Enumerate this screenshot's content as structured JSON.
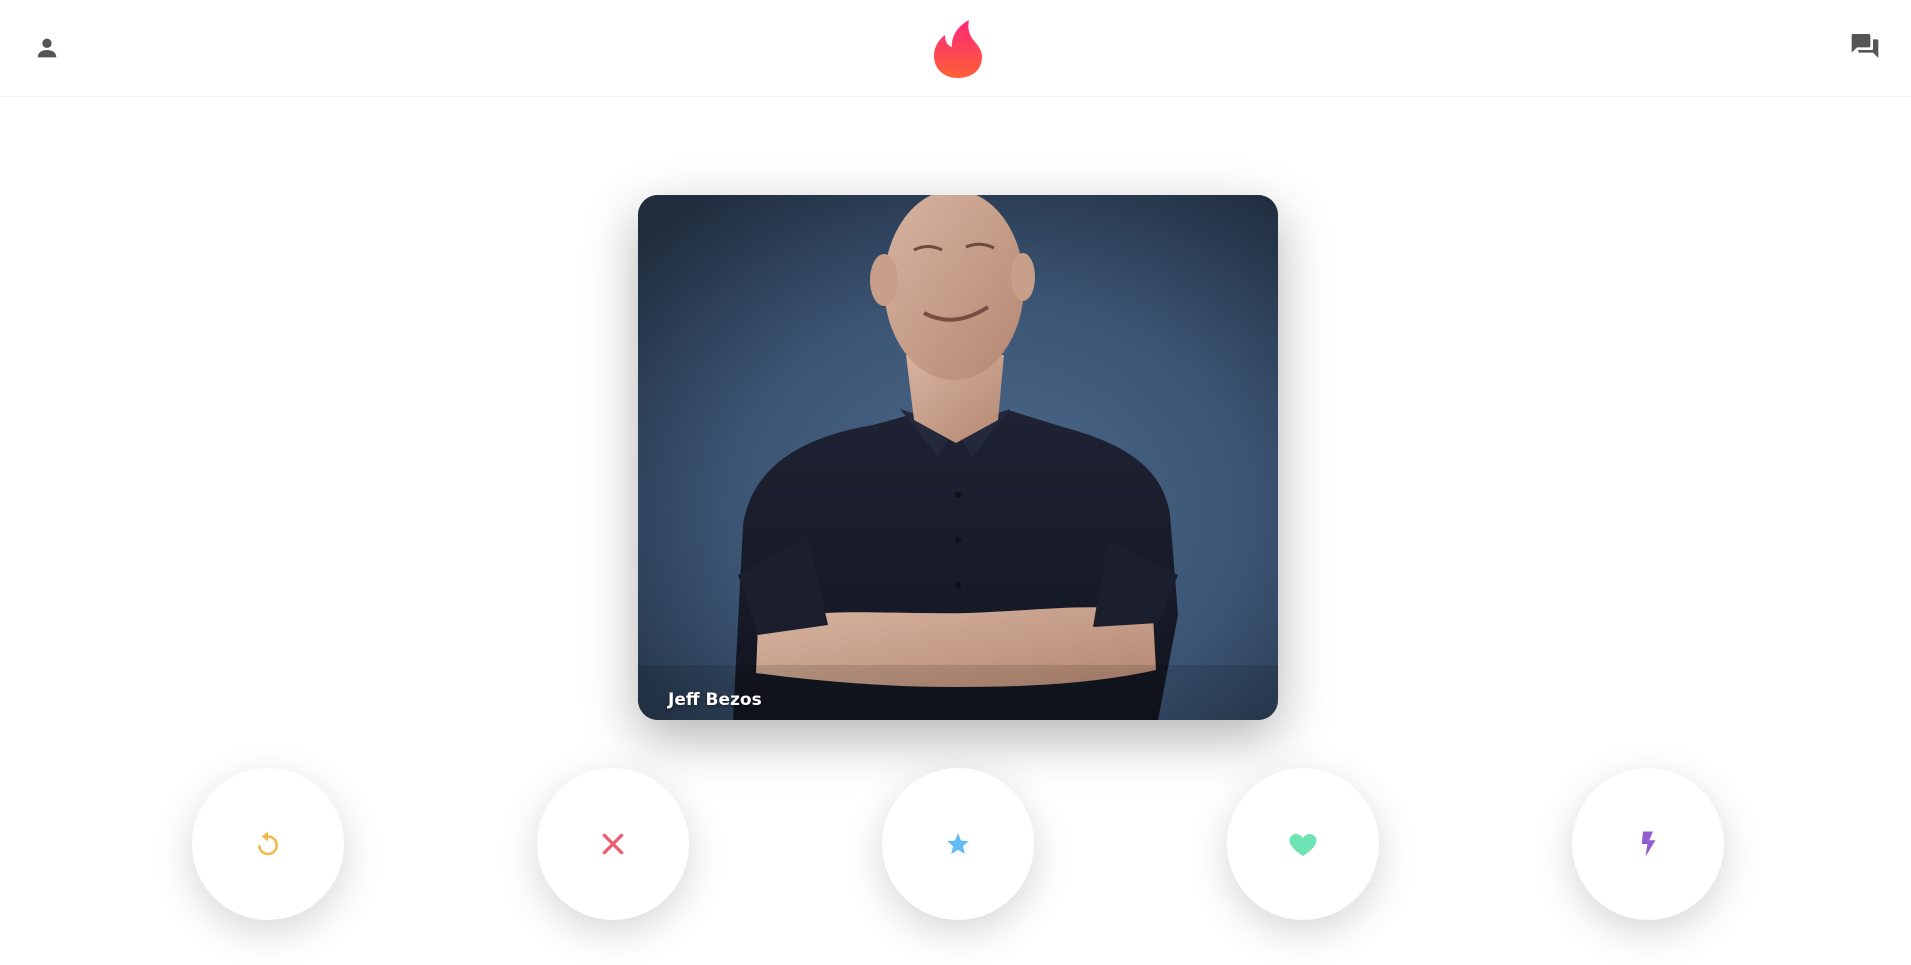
{
  "header": {
    "profile_icon": "person-icon",
    "logo_icon": "flame-logo-icon",
    "messages_icon": "chat-bubbles-icon",
    "colors": {
      "icon_gray": "#555555",
      "logo_gradient_top": "#fd267a",
      "logo_gradient_bottom": "#ff6036"
    }
  },
  "card": {
    "name": "Jeff Bezos"
  },
  "actions": [
    {
      "id": "replay",
      "icon": "replay-icon",
      "color": "#f5b748"
    },
    {
      "id": "nope",
      "icon": "close-icon",
      "color": "#ec5e6f"
    },
    {
      "id": "super_like",
      "icon": "star-icon",
      "color": "#62baf3"
    },
    {
      "id": "like",
      "icon": "heart-icon",
      "color": "#6ee3b4"
    },
    {
      "id": "boost",
      "icon": "lightning-icon",
      "color": "#915dd1"
    }
  ]
}
